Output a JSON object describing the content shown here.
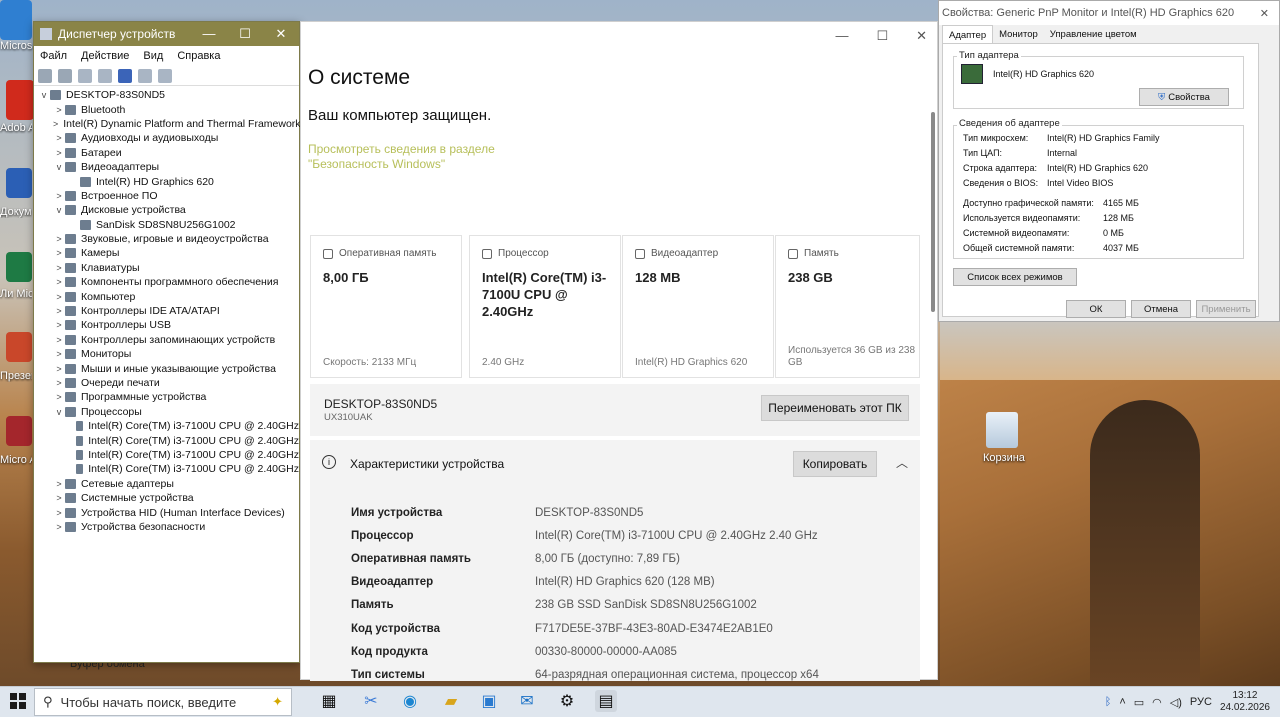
{
  "desktop": {
    "icons": [
      {
        "label": "Micros Edg"
      },
      {
        "label": "Adob Acro"
      },
      {
        "label": "Докум Micros"
      },
      {
        "label": "Ли Micro"
      },
      {
        "label": "Презен Micros"
      },
      {
        "label": "Micro Acces"
      }
    ],
    "recycle_bin_label": "Корзина",
    "clipboard_text": "Буфер обмена"
  },
  "device_manager": {
    "title": "Диспетчер устройств",
    "menu": [
      "Файл",
      "Действие",
      "Вид",
      "Справка"
    ],
    "tree": [
      {
        "label": "DESKTOP-83S0ND5",
        "level": 0,
        "expander": "v"
      },
      {
        "label": "Bluetooth",
        "level": 1,
        "expander": ">"
      },
      {
        "label": "Intel(R) Dynamic Platform and Thermal Framework",
        "level": 1,
        "expander": ">"
      },
      {
        "label": "Аудиовходы и аудиовыходы",
        "level": 1,
        "expander": ">"
      },
      {
        "label": "Батареи",
        "level": 1,
        "expander": ">"
      },
      {
        "label": "Видеоадаптеры",
        "level": 1,
        "expander": "v"
      },
      {
        "label": "Intel(R) HD Graphics 620",
        "level": 2,
        "expander": ""
      },
      {
        "label": "Встроенное ПО",
        "level": 1,
        "expander": ">"
      },
      {
        "label": "Дисковые устройства",
        "level": 1,
        "expander": "v"
      },
      {
        "label": "SanDisk SD8SN8U256G1002",
        "level": 2,
        "expander": ""
      },
      {
        "label": "Звуковые, игровые и видеоустройства",
        "level": 1,
        "expander": ">"
      },
      {
        "label": "Камеры",
        "level": 1,
        "expander": ">"
      },
      {
        "label": "Клавиатуры",
        "level": 1,
        "expander": ">"
      },
      {
        "label": "Компоненты программного обеспечения",
        "level": 1,
        "expander": ">"
      },
      {
        "label": "Компьютер",
        "level": 1,
        "expander": ">"
      },
      {
        "label": "Контроллеры IDE ATA/ATAPI",
        "level": 1,
        "expander": ">"
      },
      {
        "label": "Контроллеры USB",
        "level": 1,
        "expander": ">"
      },
      {
        "label": "Контроллеры запоминающих устройств",
        "level": 1,
        "expander": ">"
      },
      {
        "label": "Мониторы",
        "level": 1,
        "expander": ">"
      },
      {
        "label": "Мыши и иные указывающие устройства",
        "level": 1,
        "expander": ">"
      },
      {
        "label": "Очереди печати",
        "level": 1,
        "expander": ">"
      },
      {
        "label": "Программные устройства",
        "level": 1,
        "expander": ">"
      },
      {
        "label": "Процессоры",
        "level": 1,
        "expander": "v"
      },
      {
        "label": "Intel(R) Core(TM) i3-7100U CPU @ 2.40GHz",
        "level": 2,
        "expander": ""
      },
      {
        "label": "Intel(R) Core(TM) i3-7100U CPU @ 2.40GHz",
        "level": 2,
        "expander": ""
      },
      {
        "label": "Intel(R) Core(TM) i3-7100U CPU @ 2.40GHz",
        "level": 2,
        "expander": ""
      },
      {
        "label": "Intel(R) Core(TM) i3-7100U CPU @ 2.40GHz",
        "level": 2,
        "expander": ""
      },
      {
        "label": "Сетевые адаптеры",
        "level": 1,
        "expander": ">"
      },
      {
        "label": "Системные устройства",
        "level": 1,
        "expander": ">"
      },
      {
        "label": "Устройства HID (Human Interface Devices)",
        "level": 1,
        "expander": ">"
      },
      {
        "label": "Устройства безопасности",
        "level": 1,
        "expander": ">"
      }
    ]
  },
  "about": {
    "title": "О системе",
    "protected": "Ваш компьютер защищен.",
    "security_link": "Просмотреть сведения в разделе \"Безопасность Windows\"",
    "cards": [
      {
        "label": "Оперативная память",
        "value": "8,00 ГБ",
        "sub": "Скорость: 2133 МГц"
      },
      {
        "label": "Процессор",
        "value": "Intel(R) Core(TM) i3-7100U CPU @ 2.40GHz",
        "sub": "2.40 GHz"
      },
      {
        "label": "Видеоадаптер",
        "value": "128 MB",
        "sub": "Intel(R) HD Graphics 620"
      },
      {
        "label": "Память",
        "value": "238 GB",
        "sub": "Используется 36 GB из 238 GB"
      }
    ],
    "pc_name": "DESKTOP-83S0ND5",
    "pc_model": "UX310UAK",
    "rename_button": "Переименовать этот ПК",
    "specs_title": "Характеристики устройства",
    "copy_button": "Копировать",
    "specs": [
      {
        "key": "Имя устройства",
        "value": "DESKTOP-83S0ND5"
      },
      {
        "key": "Процессор",
        "value": "Intel(R) Core(TM) i3-7100U CPU @ 2.40GHz   2.40 GHz"
      },
      {
        "key": "Оперативная память",
        "value": "8,00 ГБ (доступно: 7,89 ГБ)"
      },
      {
        "key": "Видеоадаптер",
        "value": "Intel(R) HD Graphics 620 (128 MB)"
      },
      {
        "key": "Память",
        "value": "238 GB SSD SanDisk SD8SN8U256G1002"
      },
      {
        "key": "Код устройства",
        "value": "F717DE5E-37BF-43E3-80AD-E3474E2AB1E0"
      },
      {
        "key": "Код продукта",
        "value": "00330-80000-00000-AA085"
      },
      {
        "key": "Тип системы",
        "value": "64-разрядная операционная система, процессор x64"
      }
    ]
  },
  "properties": {
    "title": "Свойства: Generic PnP Monitor и Intel(R) HD Graphics 620",
    "tabs": [
      "Адаптер",
      "Монитор",
      "Управление цветом"
    ],
    "adapter_type_label": "Тип адаптера",
    "adapter_name": "Intel(R) HD Graphics 620",
    "properties_button": "Свойства",
    "info_title": "Сведения об адаптере",
    "info_rows": [
      {
        "key": "Тип микросхем:",
        "value": "Intel(R) HD Graphics Family"
      },
      {
        "key": "Тип ЦАП:",
        "value": "Internal"
      },
      {
        "key": "Строка адаптера:",
        "value": "Intel(R) HD Graphics 620"
      },
      {
        "key": "Сведения о BIOS:",
        "value": "Intel Video BIOS"
      }
    ],
    "mem_rows": [
      {
        "key": "Доступно графической памяти:",
        "value": "4165 МБ"
      },
      {
        "key": "Используется видеопамяти:",
        "value": "128 МБ"
      },
      {
        "key": "Системной видеопамяти:",
        "value": "0 МБ"
      },
      {
        "key": "Общей системной памяти:",
        "value": "4037 МБ"
      }
    ],
    "modes_button": "Список всех режимов",
    "ok_button": "ОК",
    "cancel_button": "Отмена",
    "apply_button": "Применить"
  },
  "taskbar": {
    "search_placeholder": "Чтобы начать поиск, введите",
    "language": "РУС",
    "time": "13:12",
    "date": "24.02.2026"
  }
}
